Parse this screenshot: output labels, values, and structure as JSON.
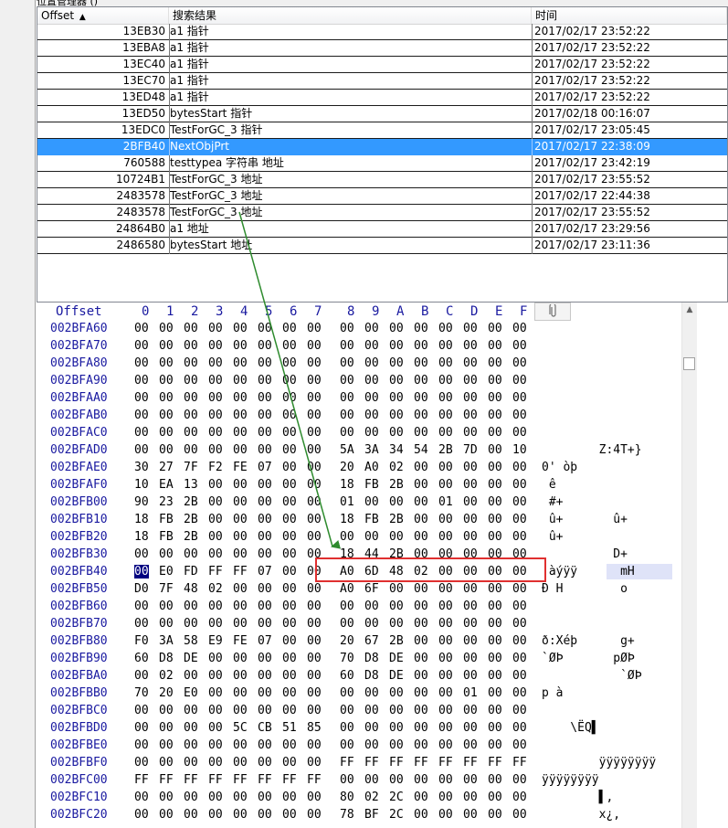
{
  "window_title": "位置管理器 ()",
  "results": {
    "headers": {
      "offset": "Offset",
      "sort_arrow": "▲",
      "result": "搜索结果",
      "time": "时间"
    },
    "rows": [
      {
        "offset": "13EB30",
        "name": "a1 指针",
        "time": "2017/02/17  23:52:22",
        "selected": false
      },
      {
        "offset": "13EBA8",
        "name": "a1 指针",
        "time": "2017/02/17  23:52:22",
        "selected": false
      },
      {
        "offset": "13EC40",
        "name": "a1 指针",
        "time": "2017/02/17  23:52:22",
        "selected": false
      },
      {
        "offset": "13EC70",
        "name": "a1 指针",
        "time": "2017/02/17  23:52:22",
        "selected": false
      },
      {
        "offset": "13ED48",
        "name": "a1 指针",
        "time": "2017/02/17  23:52:22",
        "selected": false
      },
      {
        "offset": "13ED50",
        "name": "bytesStart 指针",
        "time": "2017/02/18  00:16:07",
        "selected": false
      },
      {
        "offset": "13EDC0",
        "name": "TestForGC_3  指针",
        "time": "2017/02/17  23:05:45",
        "selected": false
      },
      {
        "offset": "2BFB40",
        "name": "NextObjPrt",
        "time": "2017/02/17  22:38:09",
        "selected": true
      },
      {
        "offset": "760588",
        "name": "testtypea 字符串 地址",
        "time": "2017/02/17  23:42:19",
        "selected": false
      },
      {
        "offset": "10724B1",
        "name": "TestForGC_3 地址",
        "time": "2017/02/17  23:55:52",
        "selected": false
      },
      {
        "offset": "2483578",
        "name": "TestForGC_3 地址",
        "time": "2017/02/17  22:44:38",
        "selected": false
      },
      {
        "offset": "2483578",
        "name": "TestForGC_3 地址",
        "time": "2017/02/17  23:55:52",
        "selected": false
      },
      {
        "offset": "24864B0",
        "name": "a1 地址",
        "time": "2017/02/17  23:29:56",
        "selected": false
      },
      {
        "offset": "2486580",
        "name": "bytesStart 地址",
        "time": "2017/02/17  23:11:36",
        "selected": false
      }
    ]
  },
  "hex": {
    "header_offset": "Offset",
    "header_cols": [
      "0",
      "1",
      "2",
      "3",
      "4",
      "5",
      "6",
      "7",
      "8",
      "9",
      "A",
      "B",
      "C",
      "D",
      "E",
      "F"
    ],
    "clip_icon": "paperclip-icon",
    "highlight_color": "#e03030",
    "arrow_color": "#2e8b2e",
    "rows": [
      {
        "addr": "002BFA60",
        "bytes": [
          "00",
          "00",
          "00",
          "00",
          "00",
          "00",
          "00",
          "00",
          "00",
          "00",
          "00",
          "00",
          "00",
          "00",
          "00",
          "00"
        ],
        "ascii": ""
      },
      {
        "addr": "002BFA70",
        "bytes": [
          "00",
          "00",
          "00",
          "00",
          "00",
          "00",
          "00",
          "00",
          "00",
          "00",
          "00",
          "00",
          "00",
          "00",
          "00",
          "00"
        ],
        "ascii": ""
      },
      {
        "addr": "002BFA80",
        "bytes": [
          "00",
          "00",
          "00",
          "00",
          "00",
          "00",
          "00",
          "00",
          "00",
          "00",
          "00",
          "00",
          "00",
          "00",
          "00",
          "00"
        ],
        "ascii": ""
      },
      {
        "addr": "002BFA90",
        "bytes": [
          "00",
          "00",
          "00",
          "00",
          "00",
          "00",
          "00",
          "00",
          "00",
          "00",
          "00",
          "00",
          "00",
          "00",
          "00",
          "00"
        ],
        "ascii": ""
      },
      {
        "addr": "002BFAA0",
        "bytes": [
          "00",
          "00",
          "00",
          "00",
          "00",
          "00",
          "00",
          "00",
          "00",
          "00",
          "00",
          "00",
          "00",
          "00",
          "00",
          "00"
        ],
        "ascii": ""
      },
      {
        "addr": "002BFAB0",
        "bytes": [
          "00",
          "00",
          "00",
          "00",
          "00",
          "00",
          "00",
          "00",
          "00",
          "00",
          "00",
          "00",
          "00",
          "00",
          "00",
          "00"
        ],
        "ascii": ""
      },
      {
        "addr": "002BFAC0",
        "bytes": [
          "00",
          "00",
          "00",
          "00",
          "00",
          "00",
          "00",
          "00",
          "00",
          "00",
          "00",
          "00",
          "00",
          "00",
          "00",
          "00"
        ],
        "ascii": ""
      },
      {
        "addr": "002BFAD0",
        "bytes": [
          "00",
          "00",
          "00",
          "00",
          "00",
          "00",
          "00",
          "00",
          "5A",
          "3A",
          "34",
          "54",
          "2B",
          "7D",
          "00",
          "10"
        ],
        "ascii": "        Z:4T+}"
      },
      {
        "addr": "002BFAE0",
        "bytes": [
          "30",
          "27",
          "7F",
          "F2",
          "FE",
          "07",
          "00",
          "00",
          "20",
          "A0",
          "02",
          "00",
          "00",
          "00",
          "00",
          "00"
        ],
        "ascii": "0' òþ"
      },
      {
        "addr": "002BFAF0",
        "bytes": [
          "10",
          "EA",
          "13",
          "00",
          "00",
          "00",
          "00",
          "00",
          "18",
          "FB",
          "2B",
          "00",
          "00",
          "00",
          "00",
          "00"
        ],
        "ascii": " ê"
      },
      {
        "addr": "002BFB00",
        "bytes": [
          "90",
          "23",
          "2B",
          "00",
          "00",
          "00",
          "00",
          "00",
          "01",
          "00",
          "00",
          "00",
          "01",
          "00",
          "00",
          "00"
        ],
        "ascii": " #+"
      },
      {
        "addr": "002BFB10",
        "bytes": [
          "18",
          "FB",
          "2B",
          "00",
          "00",
          "00",
          "00",
          "00",
          "18",
          "FB",
          "2B",
          "00",
          "00",
          "00",
          "00",
          "00"
        ],
        "ascii": " û+       û+"
      },
      {
        "addr": "002BFB20",
        "bytes": [
          "18",
          "FB",
          "2B",
          "00",
          "00",
          "00",
          "00",
          "00",
          "00",
          "00",
          "00",
          "00",
          "00",
          "00",
          "00",
          "00"
        ],
        "ascii": " û+"
      },
      {
        "addr": "002BFB30",
        "bytes": [
          "00",
          "00",
          "00",
          "00",
          "00",
          "00",
          "00",
          "00",
          "18",
          "44",
          "2B",
          "00",
          "00",
          "00",
          "00",
          "00"
        ],
        "ascii": "          D+"
      },
      {
        "addr": "002BFB40",
        "bytes": [
          "00",
          "E0",
          "FD",
          "FF",
          "FF",
          "07",
          "00",
          "00",
          "A0",
          "6D",
          "48",
          "02",
          "00",
          "00",
          "00",
          "00"
        ],
        "ascii": " àýÿÿ      mH"
      },
      {
        "addr": "002BFB50",
        "bytes": [
          "D0",
          "7F",
          "48",
          "02",
          "00",
          "00",
          "00",
          "00",
          "A0",
          "6F",
          "00",
          "00",
          "00",
          "00",
          "00",
          "00"
        ],
        "ascii": "Ð H        o"
      },
      {
        "addr": "002BFB60",
        "bytes": [
          "00",
          "00",
          "00",
          "00",
          "00",
          "00",
          "00",
          "00",
          "00",
          "00",
          "00",
          "00",
          "00",
          "00",
          "00",
          "00"
        ],
        "ascii": ""
      },
      {
        "addr": "002BFB70",
        "bytes": [
          "00",
          "00",
          "00",
          "00",
          "00",
          "00",
          "00",
          "00",
          "00",
          "00",
          "00",
          "00",
          "00",
          "00",
          "00",
          "00"
        ],
        "ascii": ""
      },
      {
        "addr": "002BFB80",
        "bytes": [
          "F0",
          "3A",
          "58",
          "E9",
          "FE",
          "07",
          "00",
          "00",
          "20",
          "67",
          "2B",
          "00",
          "00",
          "00",
          "00",
          "00"
        ],
        "ascii": "ð:Xéþ      g+"
      },
      {
        "addr": "002BFB90",
        "bytes": [
          "60",
          "D8",
          "DE",
          "00",
          "00",
          "00",
          "00",
          "00",
          "70",
          "D8",
          "DE",
          "00",
          "00",
          "00",
          "00",
          "00"
        ],
        "ascii": "`ØÞ       pØÞ"
      },
      {
        "addr": "002BFBA0",
        "bytes": [
          "00",
          "02",
          "00",
          "00",
          "00",
          "00",
          "00",
          "00",
          "60",
          "D8",
          "DE",
          "00",
          "00",
          "00",
          "00",
          "00"
        ],
        "ascii": "           `ØÞ"
      },
      {
        "addr": "002BFBB0",
        "bytes": [
          "70",
          "20",
          "E0",
          "00",
          "00",
          "00",
          "00",
          "00",
          "00",
          "00",
          "00",
          "00",
          "00",
          "01",
          "00",
          "00"
        ],
        "ascii": "p à"
      },
      {
        "addr": "002BFBC0",
        "bytes": [
          "00",
          "00",
          "00",
          "00",
          "00",
          "00",
          "00",
          "00",
          "00",
          "00",
          "00",
          "00",
          "00",
          "00",
          "00",
          "00"
        ],
        "ascii": ""
      },
      {
        "addr": "002BFBD0",
        "bytes": [
          "00",
          "00",
          "00",
          "00",
          "5C",
          "CB",
          "51",
          "85",
          "00",
          "00",
          "00",
          "00",
          "00",
          "00",
          "00",
          "00"
        ],
        "ascii": "    \\ËQ▌"
      },
      {
        "addr": "002BFBE0",
        "bytes": [
          "00",
          "00",
          "00",
          "00",
          "00",
          "00",
          "00",
          "00",
          "00",
          "00",
          "00",
          "00",
          "00",
          "00",
          "00",
          "00"
        ],
        "ascii": ""
      },
      {
        "addr": "002BFBF0",
        "bytes": [
          "00",
          "00",
          "00",
          "00",
          "00",
          "00",
          "00",
          "00",
          "FF",
          "FF",
          "FF",
          "FF",
          "FF",
          "FF",
          "FF",
          "FF"
        ],
        "ascii": "        ÿÿÿÿÿÿÿÿ"
      },
      {
        "addr": "002BFC00",
        "bytes": [
          "FF",
          "FF",
          "FF",
          "FF",
          "FF",
          "FF",
          "FF",
          "FF",
          "00",
          "00",
          "00",
          "00",
          "00",
          "00",
          "00",
          "00"
        ],
        "ascii": "ÿÿÿÿÿÿÿÿ"
      },
      {
        "addr": "002BFC10",
        "bytes": [
          "00",
          "00",
          "00",
          "00",
          "00",
          "00",
          "00",
          "00",
          "80",
          "02",
          "2C",
          "00",
          "00",
          "00",
          "00",
          "00"
        ],
        "ascii": "        ▌,"
      },
      {
        "addr": "002BFC20",
        "bytes": [
          "00",
          "00",
          "00",
          "00",
          "00",
          "00",
          "00",
          "00",
          "78",
          "BF",
          "2C",
          "00",
          "00",
          "00",
          "00",
          "00"
        ],
        "ascii": "        x¿,"
      }
    ]
  }
}
